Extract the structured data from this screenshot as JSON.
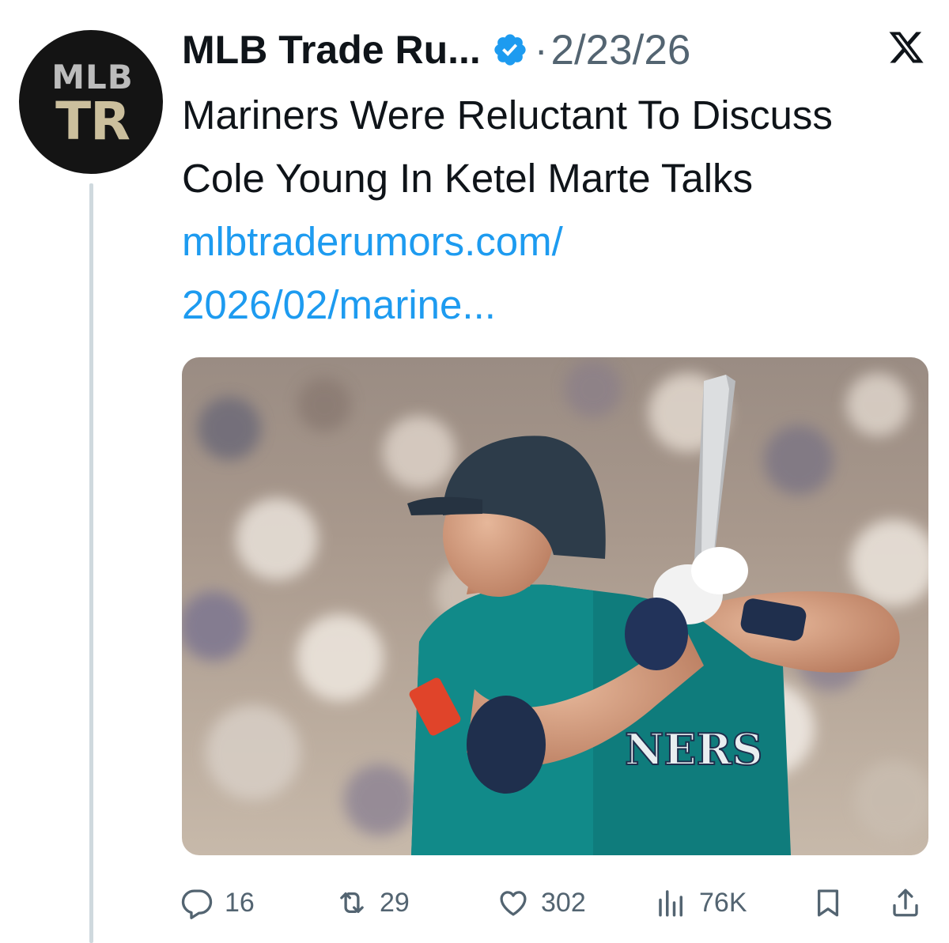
{
  "author": {
    "avatar_line1": "MLB",
    "avatar_line2": "TR",
    "name": "MLB Trade Ru...",
    "date": "2/23/26",
    "separator": "·"
  },
  "tweet": {
    "text": "Mariners Were Reluctant To Discuss Cole Young In Ketel Marte Talks",
    "link_line1": "mlbtraderumors.com/",
    "link_line2": "2026/02/marine..."
  },
  "media": {
    "jersey_text": "NERS",
    "description_icon": "baseball-player-photo"
  },
  "actions": {
    "replies": "16",
    "reposts": "29",
    "likes": "302",
    "views": "76K"
  },
  "colors": {
    "accent": "#1d9bf0",
    "muted": "#536471",
    "text": "#0f1419",
    "thread_line": "#cfd9de"
  }
}
